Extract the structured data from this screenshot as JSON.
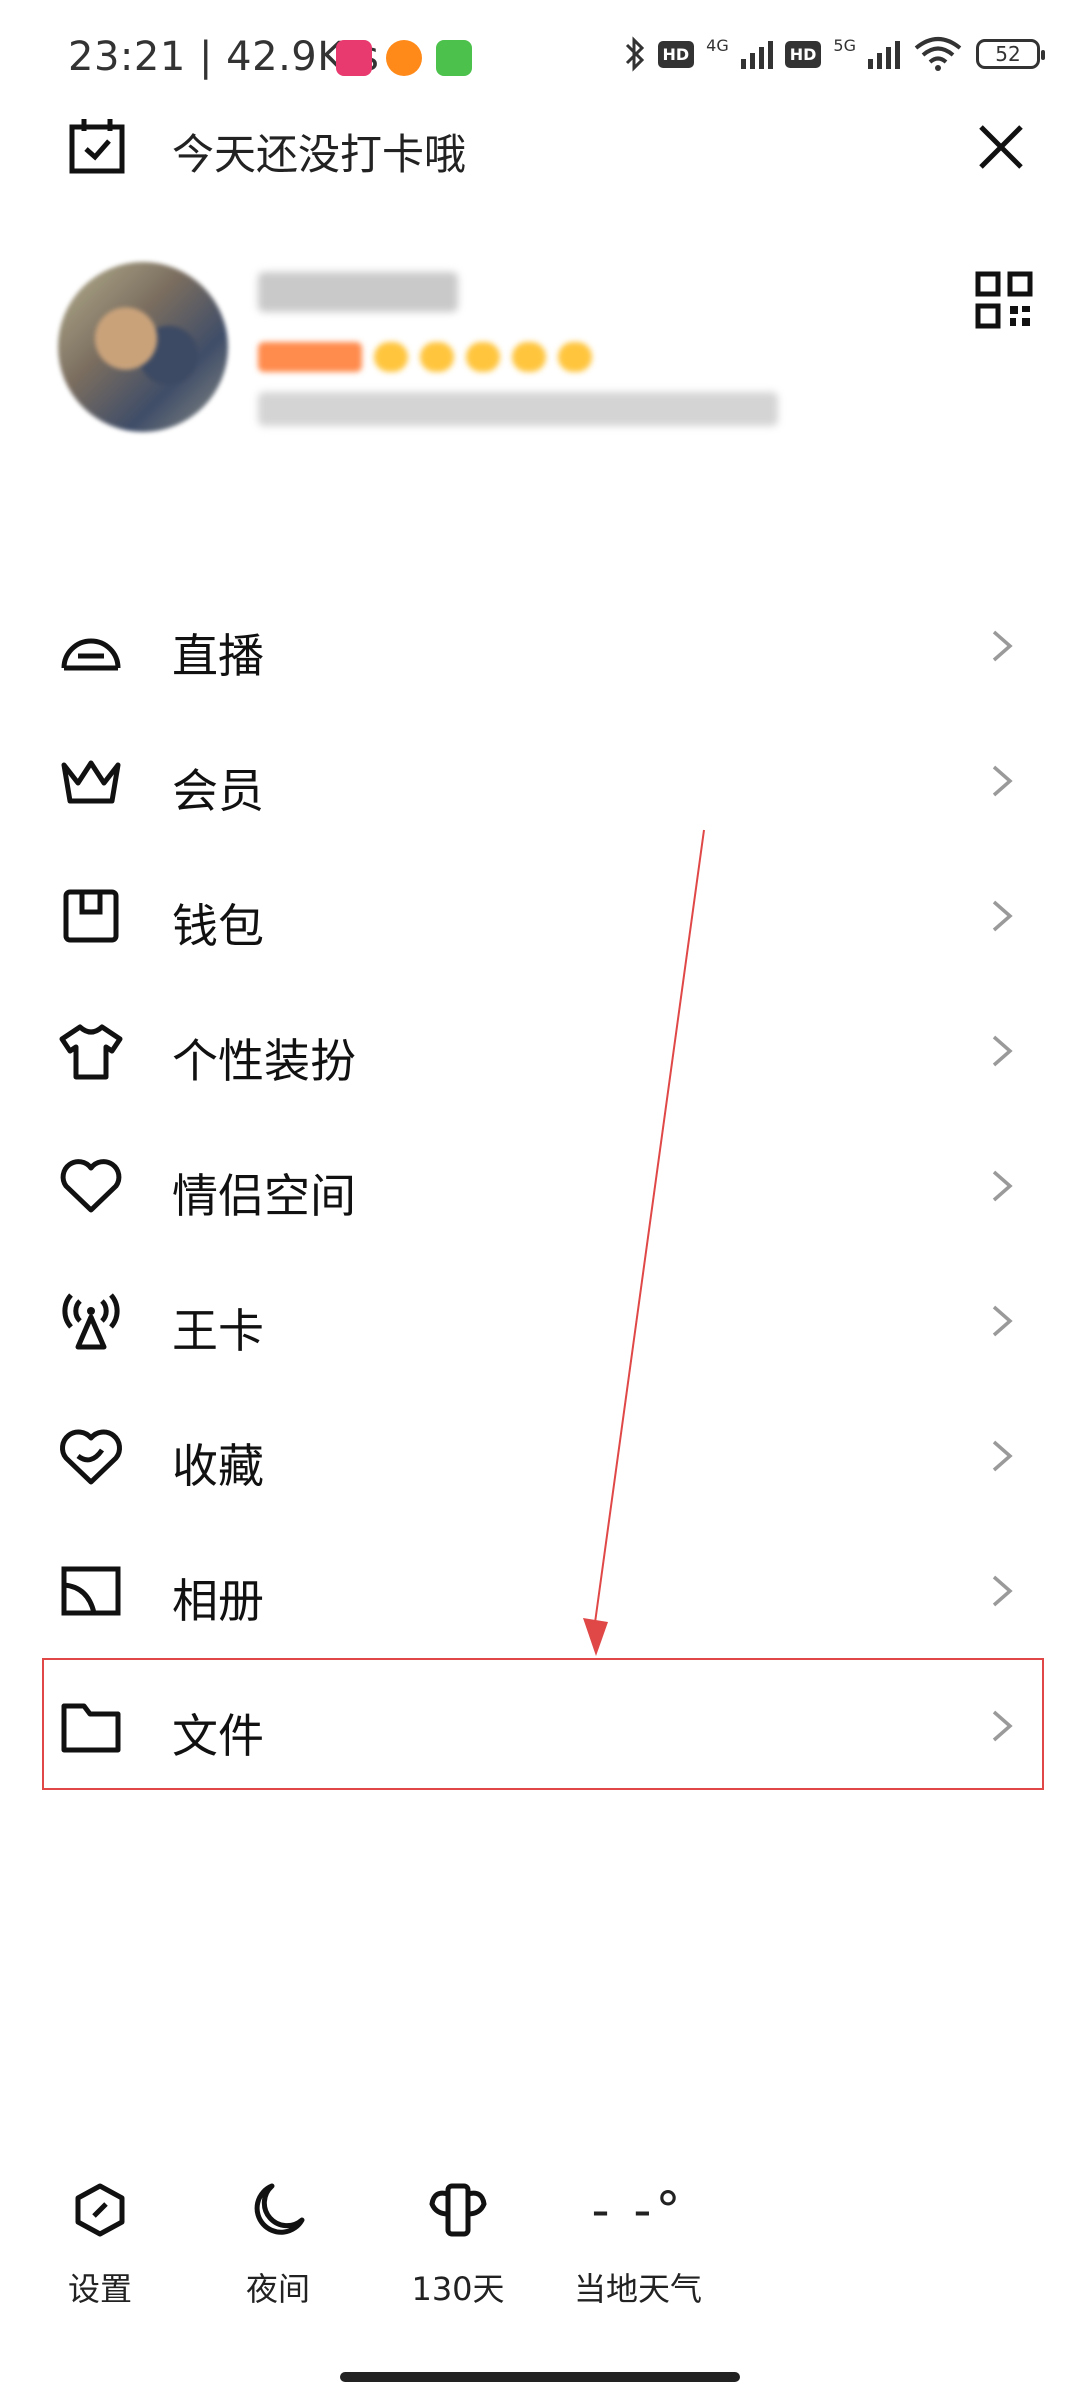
{
  "status_bar": {
    "time": "23:21 | 42.9K/s",
    "hd1": "HD",
    "net1": "4G",
    "hd2": "HD",
    "net2": "5G",
    "battery": "52"
  },
  "header": {
    "checkin_text": "今天还没打卡哦"
  },
  "menu": {
    "items": [
      {
        "label": "直播",
        "icon": "live-icon"
      },
      {
        "label": "会员",
        "icon": "crown-icon"
      },
      {
        "label": "钱包",
        "icon": "wallet-icon"
      },
      {
        "label": "个性装扮",
        "icon": "tshirt-icon"
      },
      {
        "label": "情侣空间",
        "icon": "heart-icon"
      },
      {
        "label": "王卡",
        "icon": "signal-tower-icon"
      },
      {
        "label": "收藏",
        "icon": "favorites-icon"
      },
      {
        "label": "相册",
        "icon": "album-icon"
      },
      {
        "label": "文件",
        "icon": "folder-icon"
      }
    ]
  },
  "bottom_bar": {
    "settings": "设置",
    "night": "夜间",
    "days": "130天",
    "weather_temp": "- -°",
    "weather": "当地天气"
  },
  "colors": {
    "highlight": "#e04848",
    "chevron": "#9a9a9a"
  }
}
